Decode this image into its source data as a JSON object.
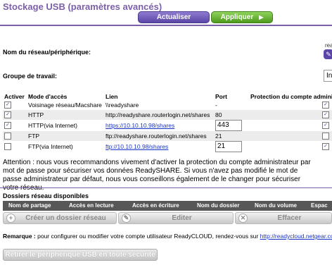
{
  "header": {
    "title": "Stockage USB (paramètres avancés)",
    "refresh_label": "Actualiser",
    "apply_label": "Appliquer"
  },
  "device": {
    "label": "Nom du réseau/périphérique:",
    "value_partial": "read"
  },
  "workgroup": {
    "label": "Groupe de travail:",
    "value_partial": "In"
  },
  "access_table": {
    "headers": [
      "Activer",
      "Mode d'accès",
      "Lien",
      "Port",
      "Protection du compte adminis"
    ],
    "rows": [
      {
        "enabled": true,
        "mode": "Voisinage réseau/Macshare",
        "link": "\\\\readyshare",
        "link_is_url": false,
        "port": "-",
        "port_editable": false,
        "protected": true
      },
      {
        "enabled": true,
        "mode": "HTTP",
        "link": "http://readyshare.routerlogin.net/shares",
        "link_is_url": false,
        "port": "80",
        "port_editable": false,
        "protected": true
      },
      {
        "enabled": true,
        "mode": "HTTP(via Internet)",
        "link": "https://10.10.10.98/shares",
        "link_is_url": true,
        "port": "443",
        "port_editable": true,
        "protected": true
      },
      {
        "enabled": false,
        "mode": "FTP",
        "link": "ftp://readyshare.routerlogin.net/shares",
        "link_is_url": false,
        "port": "21",
        "port_editable": false,
        "protected": false
      },
      {
        "enabled": false,
        "mode": "FTP(via Internet)",
        "link": "ftp://10.10.10.98/shares",
        "link_is_url": true,
        "port": "21",
        "port_editable": true,
        "protected": true
      }
    ]
  },
  "notice": "Attention : nous vous recommandons vivement d'activer la protection du compte administrateur par mot de passe pour sécuriser vos données ReadySHARE. Si vous n'avez pas modifié le mot de passe administrateur par défaut, nous vous conseillons également de le changer pour sécuriser votre réseau.",
  "folders": {
    "title": "Dossiers réseau disponibles",
    "headers": [
      "Nom de partage",
      "Accès en lecture",
      "Accès en écriture",
      "Nom du dossier",
      "Nom du volume",
      "Espac"
    ],
    "create_label": "Créer un dossier réseau",
    "edit_label": "Editer",
    "delete_label": "Effacer"
  },
  "remark": {
    "label": "Remarque :",
    "text": " pour configurer ou modifier votre compte utilisateur ReadyCLOUD, rendez-vous sur ",
    "link": "http://readycloud.netgear.com",
    "end": "."
  },
  "eject_label": "Retirer le périphérique USB en toute sécurité",
  "colors": {
    "title": "#7b5fa8",
    "refresh_button": "#5b45a6",
    "apply_button": "#4e9a1e",
    "link": "#1a35c8",
    "folder_header": "#575757"
  }
}
